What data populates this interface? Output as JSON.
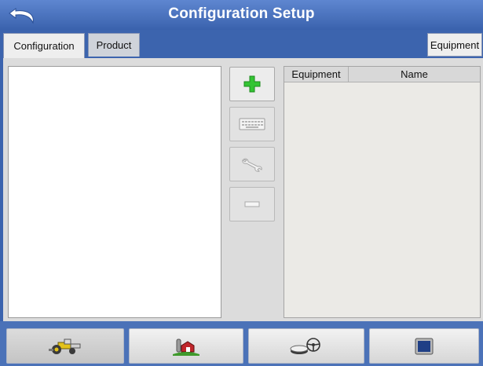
{
  "header": {
    "title": "Configuration Setup",
    "back_icon": "back-arrow-icon"
  },
  "tabs": [
    {
      "label": "Configuration",
      "active": true
    },
    {
      "label": "Product",
      "active": false
    },
    {
      "label": "Equipment",
      "active": false
    }
  ],
  "side_buttons": [
    {
      "icon": "add-plus-icon",
      "color": "#2fbf2f"
    },
    {
      "icon": "keyboard-icon"
    },
    {
      "icon": "wrench-icon"
    },
    {
      "icon": "minus-icon"
    }
  ],
  "equipment_table": {
    "columns": [
      "Equipment",
      "Name"
    ],
    "rows": []
  },
  "bottom_nav": [
    {
      "icon": "tractor-icon"
    },
    {
      "icon": "farm-icon"
    },
    {
      "icon": "gps-steering-icon"
    },
    {
      "icon": "display-icon"
    }
  ],
  "colors": {
    "header_blue": "#3c64ae",
    "panel_gray": "#dcdcdc"
  }
}
